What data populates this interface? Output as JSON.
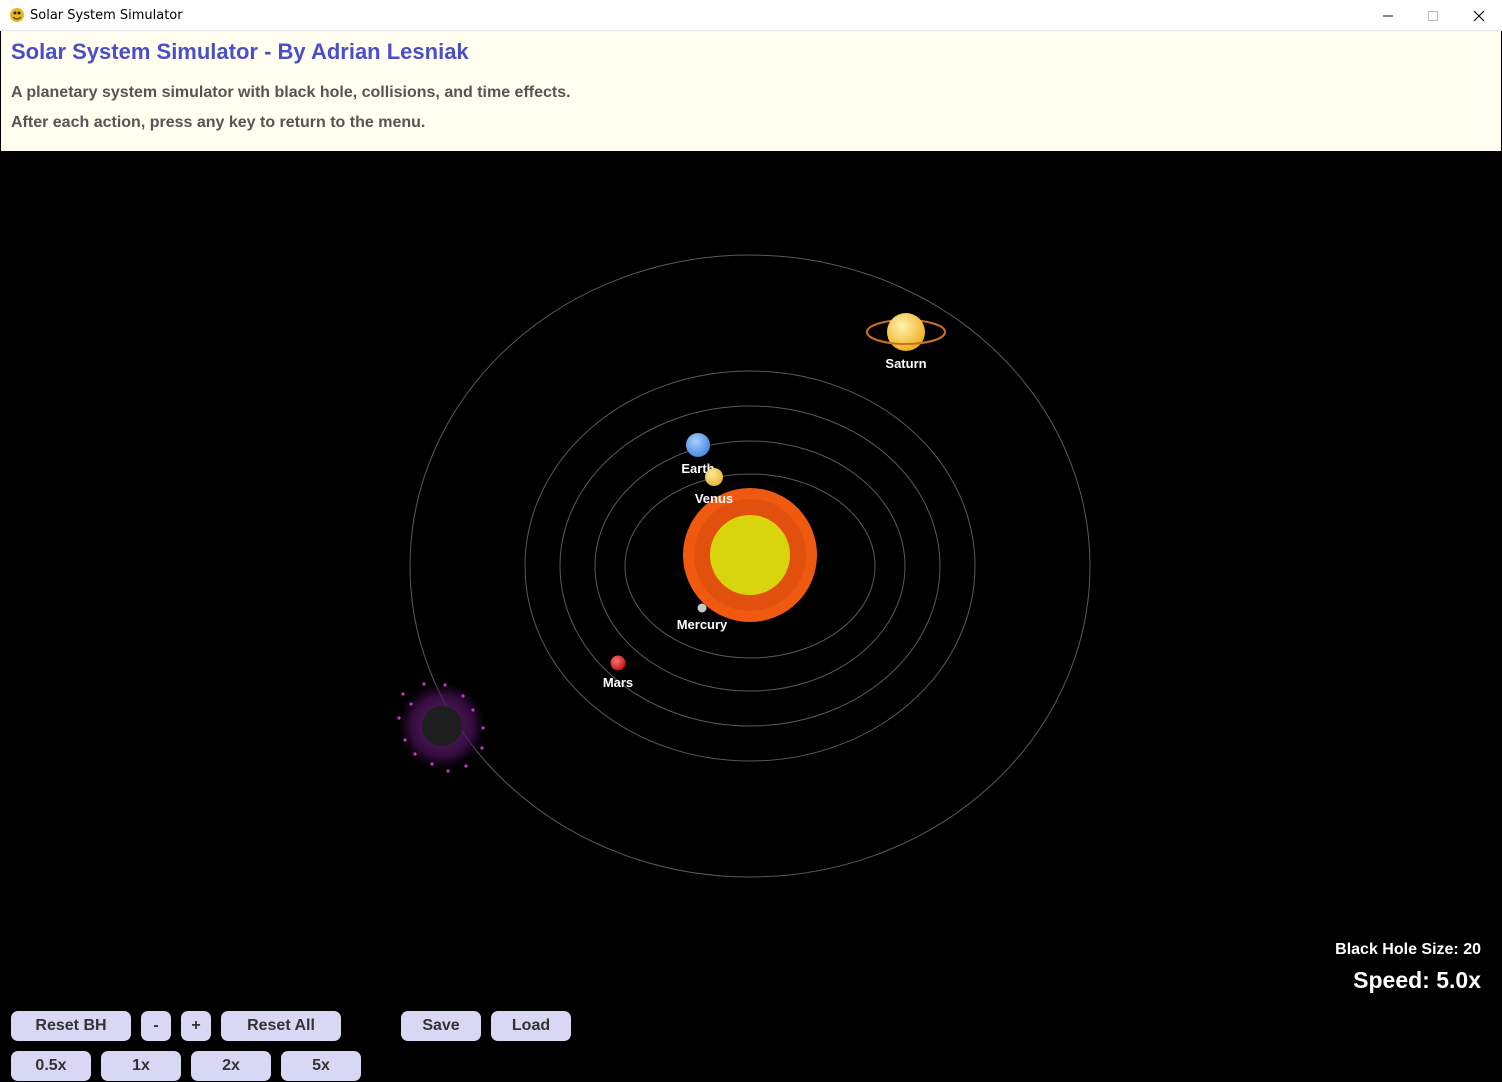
{
  "window": {
    "title": "Solar System Simulator",
    "minimize": "—",
    "maximize": "☐",
    "close": "✕"
  },
  "header": {
    "title": "Solar System Simulator - By Adrian Lesniak",
    "line1": "A planetary system simulator with black hole, collisions, and time effects.",
    "line2": "After each action, press any key to return to the menu."
  },
  "planets": {
    "saturn": "Saturn",
    "earth": "Earth",
    "venus": "Venus",
    "mercury": "Mercury",
    "mars": "Mars"
  },
  "status": {
    "black_hole_size": "Black Hole Size: 20",
    "speed": "Speed: 5.0x"
  },
  "buttons": {
    "reset_bh": "Reset BH",
    "minus": "-",
    "plus": "+",
    "reset_all": "Reset All",
    "save": "Save",
    "load": "Load",
    "speed_05": "0.5x",
    "speed_1": "1x",
    "speed_2": "2x",
    "speed_5": "5x"
  },
  "colors": {
    "title": "#4a4fc7",
    "header_bg": "#fffef0",
    "button_bg": "#d8d8f4",
    "sun_outer": "#f05a10",
    "sun_core": "#d8d40e"
  }
}
